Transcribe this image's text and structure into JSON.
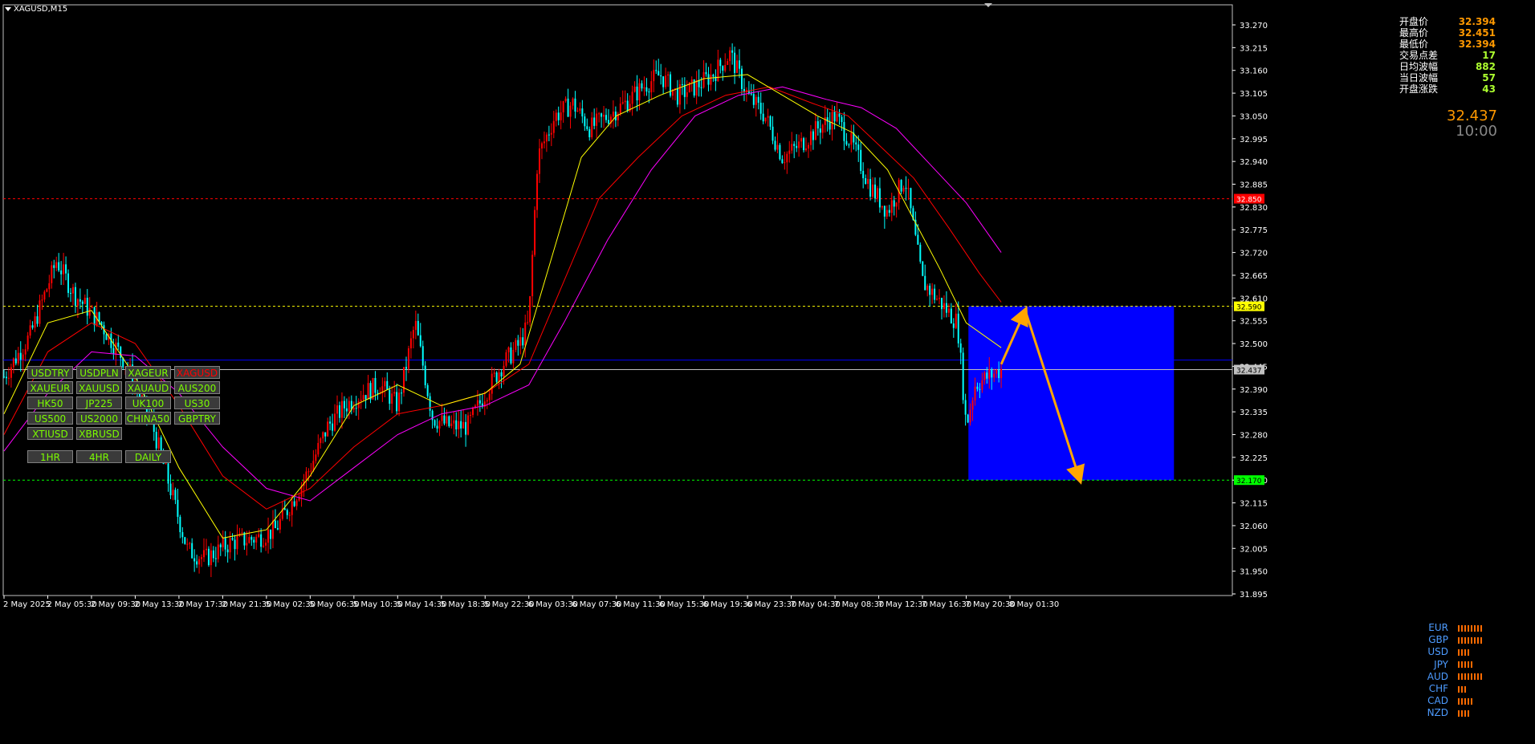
{
  "symbol_title": "XAGUSD,M15",
  "info_panel": {
    "rows": [
      {
        "label": "开盘价",
        "value": "32.394"
      },
      {
        "label": "最高价",
        "value": "32.451"
      },
      {
        "label": "最低价",
        "value": "32.394"
      },
      {
        "label": "交易点差",
        "value": "17"
      },
      {
        "label": "日均波幅",
        "value": "882"
      },
      {
        "label": "当日波幅",
        "value": "57"
      },
      {
        "label": "开盘涨跌",
        "value": "43"
      }
    ],
    "current_price": "32.437",
    "countdown": "10:00"
  },
  "symbol_buttons": [
    [
      "USDTRY",
      "USDPLN",
      "XAGEUR",
      "XAGUSD"
    ],
    [
      "XAUEUR",
      "XAUUSD",
      "XAUAUD",
      "AUS200"
    ],
    [
      "HK50",
      "JP225",
      "UK100",
      "US30"
    ],
    [
      "US500",
      "US2000",
      "CHINA50",
      "GBPTRY"
    ],
    [
      "XTIUSD",
      "XBRUSD"
    ]
  ],
  "active_symbol": "XAGUSD",
  "timeframe_buttons": [
    "1HR",
    "4HR",
    "DAILY"
  ],
  "currency_strength": [
    {
      "ccy": "EUR",
      "bars": 8
    },
    {
      "ccy": "GBP",
      "bars": 8
    },
    {
      "ccy": "USD",
      "bars": 4
    },
    {
      "ccy": "JPY",
      "bars": 5
    },
    {
      "ccy": "AUD",
      "bars": 8
    },
    {
      "ccy": "CHF",
      "bars": 3
    },
    {
      "ccy": "CAD",
      "bars": 5
    },
    {
      "ccy": "NZD",
      "bars": 4
    }
  ],
  "colors": {
    "bull": "#ff0000",
    "bear": "#00ffff",
    "ma_fast": "#ffff00",
    "ma_mid": "#ff0000",
    "ma_slow": "#ff00ff",
    "zone": "#0000ff",
    "arrow": "#ffa500",
    "axis": "#ffffff"
  },
  "chart_data": {
    "type": "candlestick",
    "symbol": "XAGUSD",
    "timeframe": "M15",
    "ylim": [
      31.895,
      33.27
    ],
    "y_ticks": [
      "33.270",
      "33.215",
      "33.160",
      "33.105",
      "33.050",
      "32.995",
      "32.940",
      "32.885",
      "32.830",
      "32.775",
      "32.720",
      "32.665",
      "32.610",
      "32.555",
      "32.500",
      "32.445",
      "32.390",
      "32.335",
      "32.280",
      "32.225",
      "32.170",
      "32.115",
      "32.060",
      "32.005",
      "31.950",
      "31.895"
    ],
    "x_labels": [
      "2 May 2025",
      "2 May 05:30",
      "2 May 09:30",
      "2 May 13:30",
      "2 May 17:30",
      "2 May 21:30",
      "5 May 02:30",
      "5 May 06:30",
      "5 May 10:30",
      "5 May 14:30",
      "5 May 18:30",
      "5 May 22:30",
      "6 May 03:30",
      "6 May 07:30",
      "6 May 11:30",
      "6 May 15:30",
      "6 May 19:30",
      "6 May 23:30",
      "7 May 04:30",
      "7 May 08:30",
      "7 May 12:30",
      "7 May 16:30",
      "7 May 20:30",
      "8 May 01:30"
    ],
    "x_label_positions": [
      0,
      1,
      2,
      3,
      4,
      5,
      6,
      7,
      8,
      9,
      10,
      11,
      12,
      13,
      14,
      15,
      16,
      17,
      18,
      19,
      20,
      21,
      22,
      23
    ],
    "price_path": [
      [
        0,
        32.42
      ],
      [
        0.6,
        32.52
      ],
      [
        1.2,
        32.7
      ],
      [
        1.6,
        32.62
      ],
      [
        2.2,
        32.55
      ],
      [
        2.8,
        32.45
      ],
      [
        3.4,
        32.3
      ],
      [
        3.8,
        32.15
      ],
      [
        4.2,
        32.0
      ],
      [
        4.6,
        31.98
      ],
      [
        5.2,
        32.02
      ],
      [
        5.8,
        32.03
      ],
      [
        6.2,
        32.05
      ],
      [
        6.6,
        32.12
      ],
      [
        7.0,
        32.2
      ],
      [
        7.4,
        32.3
      ],
      [
        7.8,
        32.35
      ],
      [
        8.2,
        32.38
      ],
      [
        8.6,
        32.4
      ],
      [
        9.0,
        32.35
      ],
      [
        9.4,
        32.55
      ],
      [
        9.8,
        32.32
      ],
      [
        10.2,
        32.3
      ],
      [
        10.6,
        32.3
      ],
      [
        11.0,
        32.38
      ],
      [
        11.4,
        32.45
      ],
      [
        11.8,
        32.5
      ],
      [
        12.0,
        32.55
      ],
      [
        12.2,
        32.95
      ],
      [
        12.6,
        33.05
      ],
      [
        13.0,
        33.08
      ],
      [
        13.4,
        33.02
      ],
      [
        13.8,
        33.05
      ],
      [
        14.2,
        33.08
      ],
      [
        14.6,
        33.12
      ],
      [
        15.0,
        33.15
      ],
      [
        15.4,
        33.1
      ],
      [
        15.8,
        33.12
      ],
      [
        16.2,
        33.15
      ],
      [
        16.6,
        33.2
      ],
      [
        17.0,
        33.1
      ],
      [
        17.4,
        33.05
      ],
      [
        17.8,
        32.95
      ],
      [
        18.2,
        32.98
      ],
      [
        18.6,
        33.02
      ],
      [
        19.0,
        33.05
      ],
      [
        19.4,
        32.98
      ],
      [
        19.8,
        32.88
      ],
      [
        20.2,
        32.82
      ],
      [
        20.6,
        32.9
      ],
      [
        21.0,
        32.65
      ],
      [
        21.4,
        32.6
      ],
      [
        21.8,
        32.55
      ],
      [
        22.0,
        32.3
      ],
      [
        22.2,
        32.4
      ],
      [
        22.5,
        32.42
      ],
      [
        22.8,
        32.437
      ]
    ],
    "ma_fast": [
      [
        0,
        32.33
      ],
      [
        1,
        32.55
      ],
      [
        2,
        32.58
      ],
      [
        3,
        32.42
      ],
      [
        4,
        32.2
      ],
      [
        5,
        32.03
      ],
      [
        6,
        32.05
      ],
      [
        7,
        32.18
      ],
      [
        8,
        32.35
      ],
      [
        9,
        32.4
      ],
      [
        10,
        32.35
      ],
      [
        11,
        32.38
      ],
      [
        11.8,
        32.45
      ],
      [
        12.5,
        32.7
      ],
      [
        13.2,
        32.95
      ],
      [
        14,
        33.05
      ],
      [
        15,
        33.1
      ],
      [
        16,
        33.14
      ],
      [
        17,
        33.15
      ],
      [
        17.8,
        33.1
      ],
      [
        18.6,
        33.05
      ],
      [
        19.4,
        33.01
      ],
      [
        20.2,
        32.92
      ],
      [
        20.8,
        32.8
      ],
      [
        21.4,
        32.68
      ],
      [
        22,
        32.55
      ],
      [
        22.8,
        32.49
      ]
    ],
    "ma_mid": [
      [
        0,
        32.28
      ],
      [
        1,
        32.48
      ],
      [
        2,
        32.55
      ],
      [
        3,
        32.5
      ],
      [
        4,
        32.35
      ],
      [
        5,
        32.18
      ],
      [
        6,
        32.1
      ],
      [
        7,
        32.15
      ],
      [
        8,
        32.25
      ],
      [
        9,
        32.33
      ],
      [
        10,
        32.35
      ],
      [
        11,
        32.38
      ],
      [
        12,
        32.45
      ],
      [
        12.8,
        32.65
      ],
      [
        13.6,
        32.85
      ],
      [
        14.5,
        32.95
      ],
      [
        15.5,
        33.05
      ],
      [
        16.5,
        33.1
      ],
      [
        17.5,
        33.12
      ],
      [
        18.5,
        33.08
      ],
      [
        19.3,
        33.05
      ],
      [
        20,
        32.98
      ],
      [
        20.8,
        32.9
      ],
      [
        21.6,
        32.78
      ],
      [
        22.3,
        32.67
      ],
      [
        22.8,
        32.6
      ]
    ],
    "ma_slow": [
      [
        0,
        32.24
      ],
      [
        1,
        32.38
      ],
      [
        2,
        32.48
      ],
      [
        3,
        32.47
      ],
      [
        4,
        32.38
      ],
      [
        5,
        32.25
      ],
      [
        6,
        32.15
      ],
      [
        7,
        32.12
      ],
      [
        8,
        32.2
      ],
      [
        9,
        32.28
      ],
      [
        10,
        32.33
      ],
      [
        11,
        32.35
      ],
      [
        12,
        32.4
      ],
      [
        12.8,
        32.55
      ],
      [
        13.8,
        32.75
      ],
      [
        14.8,
        32.92
      ],
      [
        15.8,
        33.05
      ],
      [
        16.8,
        33.1
      ],
      [
        17.8,
        33.12
      ],
      [
        18.8,
        33.09
      ],
      [
        19.6,
        33.07
      ],
      [
        20.4,
        33.02
      ],
      [
        21.2,
        32.93
      ],
      [
        22,
        32.84
      ],
      [
        22.8,
        32.72
      ]
    ],
    "horizontal_lines": [
      {
        "price": 32.85,
        "color": "#ff0000",
        "label": "32.850",
        "style": "dashed"
      },
      {
        "price": 32.59,
        "color": "#ffff00",
        "label": "32.590",
        "style": "dashed"
      },
      {
        "price": 32.17,
        "color": "#00ff00",
        "label": "32.170",
        "style": "dashed"
      },
      {
        "price": 32.46,
        "color": "#0000ff",
        "label": "",
        "style": "solid"
      },
      {
        "price": 32.437,
        "color": "#c0c0c0",
        "label": "32.437",
        "style": "solid"
      }
    ],
    "zone": {
      "x_start": 22.05,
      "x_end": 26.75,
      "price_top": 32.59,
      "price_bottom": 32.17
    },
    "projection": [
      [
        22.8,
        32.45
      ],
      [
        23.35,
        32.58
      ],
      [
        24.6,
        32.17
      ]
    ]
  }
}
